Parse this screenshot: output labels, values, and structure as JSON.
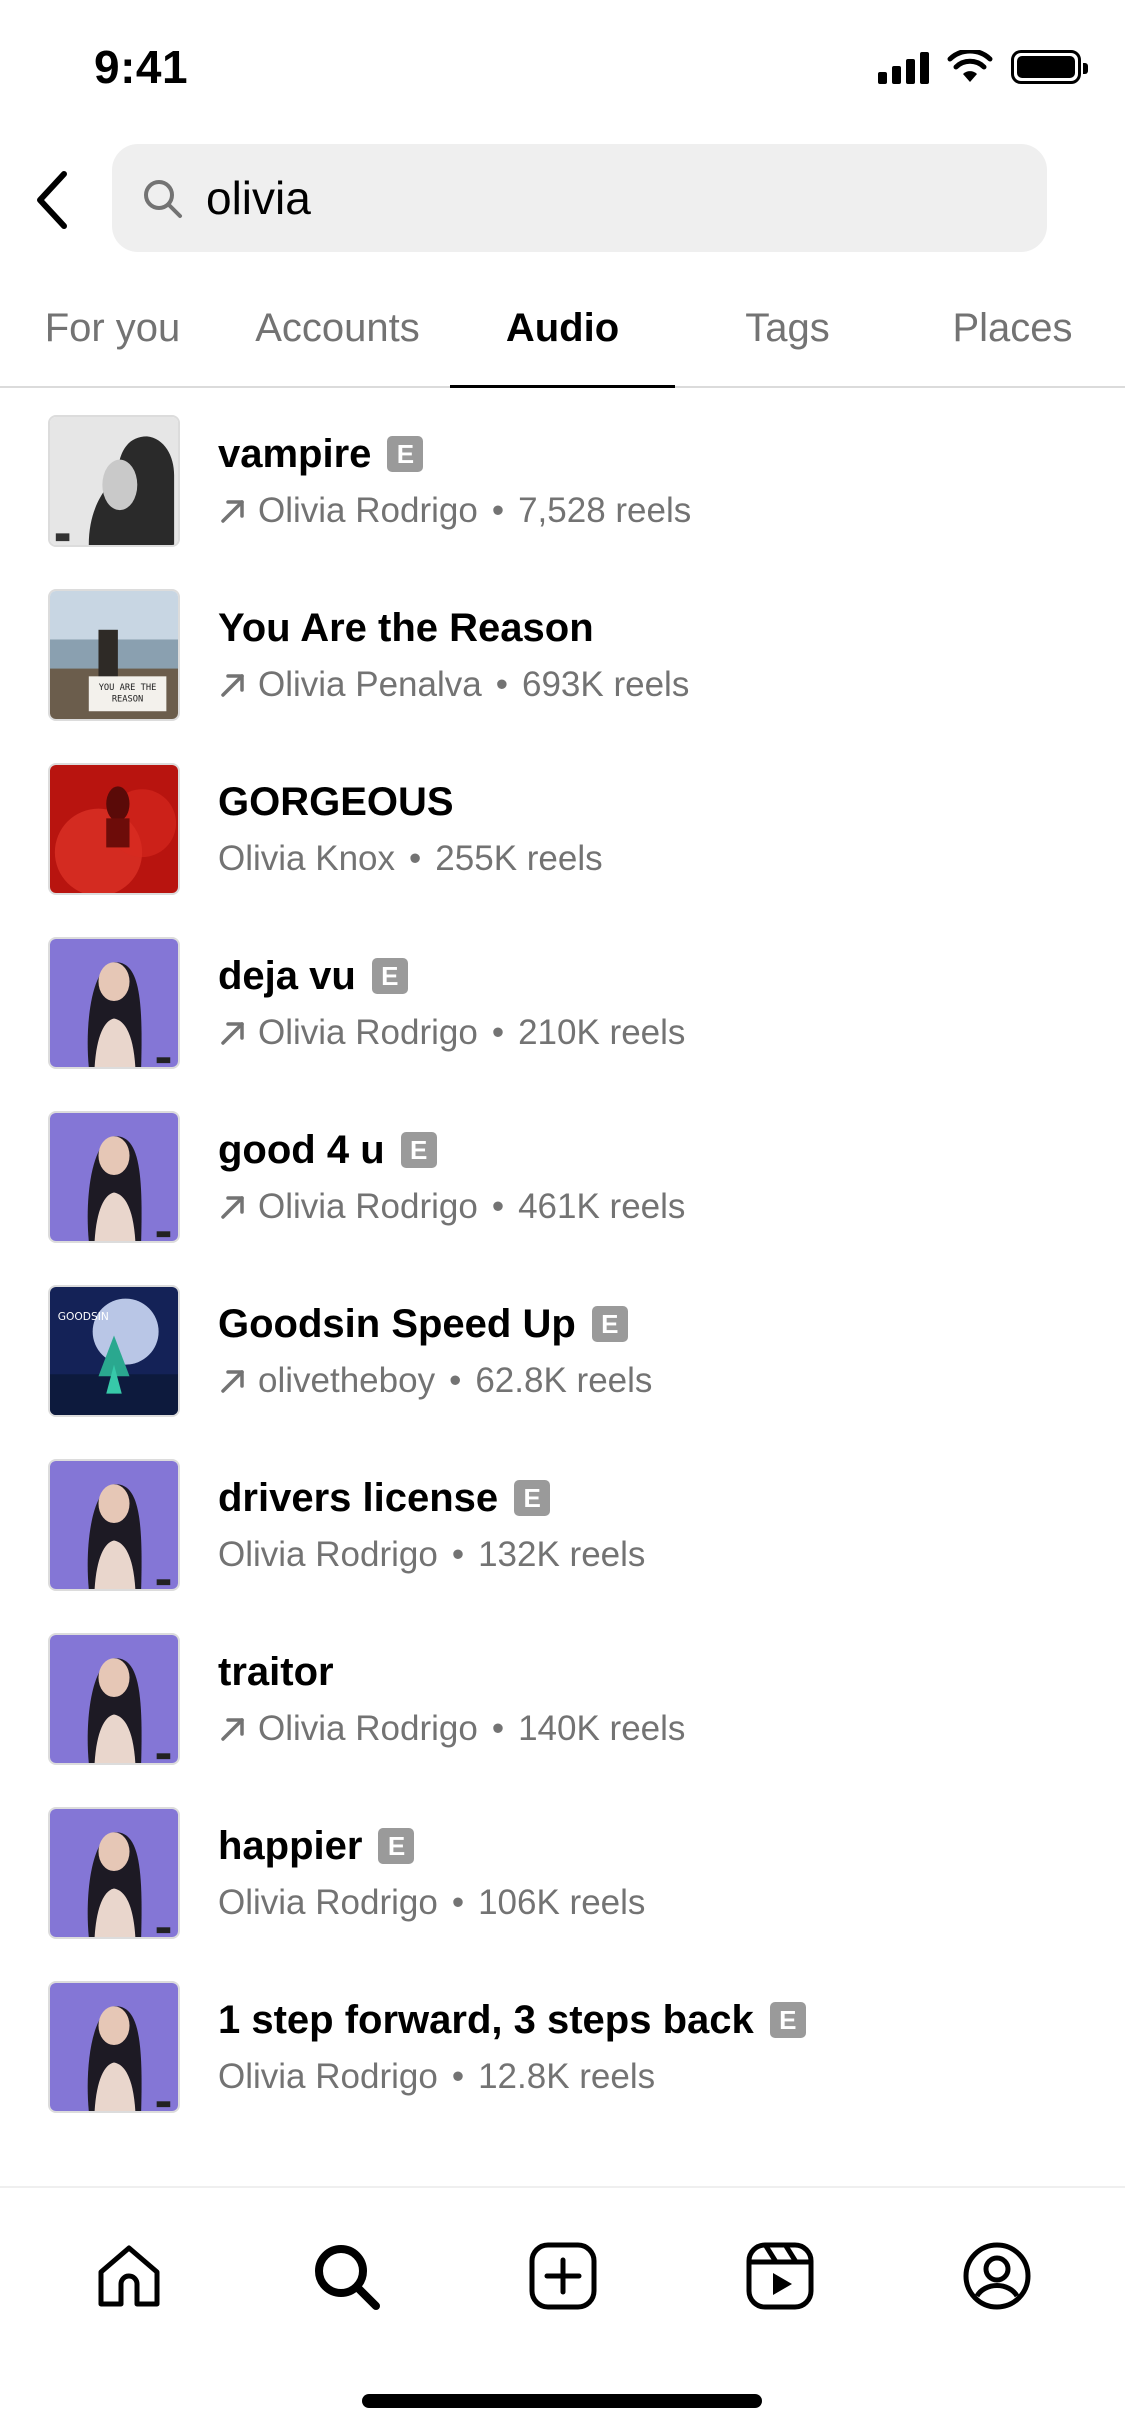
{
  "status_bar": {
    "time": "9:41"
  },
  "search": {
    "value": "olivia"
  },
  "tabs": [
    {
      "label": "For you"
    },
    {
      "label": "Accounts"
    },
    {
      "label": "Audio"
    },
    {
      "label": "Tags"
    },
    {
      "label": "Places"
    }
  ],
  "active_tab": "Audio",
  "audio_results": [
    {
      "title": "vampire",
      "explicit": "E",
      "artist": "Olivia Rodrigo",
      "reels": "7,528 reels",
      "trending": true,
      "cover": "grayscale-portrait"
    },
    {
      "title": "You Are the Reason",
      "artist": "Olivia Penalva",
      "reels": "693K reels",
      "trending": true,
      "cover": "seaside-photo"
    },
    {
      "title": "GORGEOUS",
      "artist": "Olivia Knox",
      "reels": "255K reels",
      "trending": false,
      "cover": "red-smoke"
    },
    {
      "title": "deja vu",
      "explicit": "E",
      "artist": "Olivia Rodrigo",
      "reels": "210K reels",
      "trending": true,
      "cover": "purple-portrait"
    },
    {
      "title": "good 4 u",
      "explicit": "E",
      "artist": "Olivia Rodrigo",
      "reels": "461K reels",
      "trending": true,
      "cover": "purple-portrait"
    },
    {
      "title": "Goodsin Speed Up",
      "explicit": "E",
      "artist": "olivetheboy",
      "reels": "62.8K reels",
      "trending": true,
      "cover": "blue-night"
    },
    {
      "title": "drivers license",
      "explicit": "E",
      "artist": "Olivia Rodrigo",
      "reels": "132K reels",
      "trending": false,
      "cover": "purple-portrait"
    },
    {
      "title": "traitor",
      "artist": "Olivia Rodrigo",
      "reels": "140K reels",
      "trending": true,
      "cover": "purple-portrait"
    },
    {
      "title": "happier",
      "explicit": "E",
      "artist": "Olivia Rodrigo",
      "reels": "106K reels",
      "trending": false,
      "cover": "purple-portrait"
    },
    {
      "title": "1 step forward, 3 steps back",
      "explicit": "E",
      "artist": "Olivia Rodrigo",
      "reels": "12.8K reels",
      "trending": false,
      "cover": "purple-portrait"
    }
  ],
  "cover_text": {
    "seaside-photo": "YOU ARE THE REASON",
    "blue-night": "GOODSIN"
  },
  "bottom_nav": [
    {
      "icon": "home-icon"
    },
    {
      "icon": "search-icon"
    },
    {
      "icon": "create-icon"
    },
    {
      "icon": "reels-icon"
    },
    {
      "icon": "profile-icon"
    }
  ],
  "separator": "•"
}
